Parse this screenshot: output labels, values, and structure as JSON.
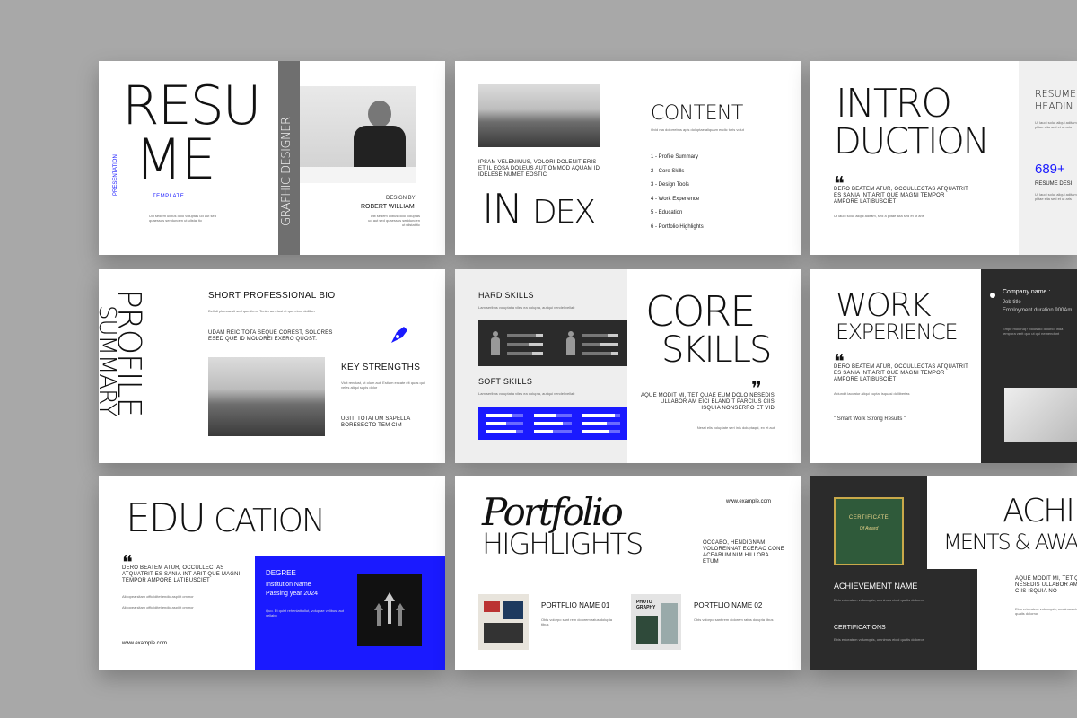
{
  "slide1": {
    "title_top": "RESU",
    "title_bottom": "ME",
    "presentation": "PRESENTATION",
    "template": "TEMPLATE",
    "vertical": "GRAPHIC DESIGNER",
    "design_by": "DESIGN BY",
    "author": "ROBERT WILLIAM",
    "body": "Ulit sedem ulibus dolo voluptas ud aut sed quaessus seridunden ut ulistat tic"
  },
  "slide2": {
    "tagline": "IPSAM VELENIMUS, VOLORI DOLENIT ERIS ET IL EOSA DOLEUS AUT OMMOD AQUAM ID IDELESE NUMET EOSTIC",
    "in": "IN",
    "dex": "DEX",
    "content": "CONTENT",
    "content_sub": "Ovid ma dolorrebus apis doluptae aliquam endic toris volut",
    "items": [
      "1 - Profile Summary",
      "2 - Core Skills",
      "3 - Design Tools",
      "4 - Work Experience",
      "5 - Education",
      "6 - Portfolio Highlights"
    ]
  },
  "slide3": {
    "title_top": "INTRO",
    "title_bottom": "DUCTION",
    "quote": "DERO BEATEM ATUR, OCCULLECTAS ATQUATRIT ES SANIA INT ARIT QUE MAGNI TEMPOR AMPORE LATIBUSCIET",
    "body": "Ut laudi solut aliqui aditam, sed a plitae sita sed et ut aris",
    "side_head_1": "RESUME",
    "side_head_2": "HEADIN",
    "number": "689+",
    "number_label": "RESUME DESI"
  },
  "slide4": {
    "vertical_1": "PROFILE",
    "vertical_2": "SUMMARY",
    "bio_title": "SHORT PROFESSIONAL BIO",
    "bio_body": "Dellidi plaecaesit sed quesitem. Tenim au etust et quo eiunt dolliber",
    "caps": "UDAM REIC TOTA SEQUE COREST, SOLORES ESED QUE ID MOLOREI EXERO QUOST.",
    "strengths": "KEY STRENGTHS",
    "strengths_body": "Vicit rendust, ut olum aut. Estiam excate elt quos qui veles aliqui sapis dolor",
    "caps_2": "UGIT, TOTATUM SAPELLA BORESECTO TEM CIM"
  },
  "slide5": {
    "hard": "HARD SKILLS",
    "hard_body": "Lam seribus voluptatia viles ea dolupta, autiqui vendel vellab",
    "soft": "SOFT SKILLS",
    "soft_body": "Lam seribus voluptatia viles ea dolupta, autiqui vendel vellab",
    "core": "CORE",
    "skills": "SKILLS",
    "quote": "AQUE MODIT MI, TET QUAE EUM DOLO NESEDIS ULLABOR AM EICI BLANDIT PARCIUS CIIS ISQUIA NONSERRO ET VID",
    "body": "Nessi elis voluptate seri inis doluptaqui, ex et aut"
  },
  "slide6": {
    "title_top": "WORK",
    "title_bottom": "EXPERIENCE",
    "quote": "DERO BEATEM ATUR, OCCULLECTAS ATQUATRIT ES SANIA INT ARIT QUE MAGNI TEMPOR AMPORE LATIBUSCIET",
    "body": "Aciundit laccatur aliqui cuptat isquasi dolliberias",
    "motto": "\" Smart Work Strong Results \"",
    "company": "Company name :",
    "job": "Job title",
    "duration": "Employment duration 900Am",
    "side_body": "Empe moloruq? Moosdio dolorio, inda tempora verit quo ut qui nemendunt"
  },
  "slide7": {
    "title_bold": "EDU",
    "title_thin": "CATION",
    "quote": "DERO BEATEM ATUR, OCCULLECTAS ATQUATRIT ES SANIA INT ARIT QUE MAGNI TEMPOR AMPORE LATIBUSCIET",
    "body": "Alicopea sitam officiiditet endic aspirit ommor",
    "url": "www.example.com",
    "degree": "DEGREE",
    "institution": "Institution Name",
    "year": "Passing year 2024",
    "box_body": "Quo. Et quist reheniatt ollut, voluptae velibust aut vellabo"
  },
  "slide8": {
    "title_script": "Portfolio",
    "title_caps": "HIGHLIGHTS",
    "url": "www.example.com",
    "quote": "OCCABO, HENDIGNAM VOLORENNAT ECERAC CONE ACEARUM NIM HILLORA ETUM",
    "p1": "PORTFLIO NAME 01",
    "p2": "PORTFLIO NAME 02",
    "p_body": "Obis volorpo sant rem dolorem ratus dolupta tibus",
    "photo_label": "PHOTO GRAPHY"
  },
  "slide9": {
    "title_1": "ACHIE",
    "title_2": "MENTS & AWA",
    "certificate": "CERTIFICATE",
    "cert_sub": "Of Award",
    "achievement": "ACHIEVEMENT NAME",
    "certifications": "CERTIFICATIONS",
    "body": "Ebis ericeatem volumquis, omnimus eicid quatis dolorror",
    "quote": "AQUE MODIT MI, TET Q NESEDIS ULLABOR AM CIIS ISQUIA NO"
  },
  "colors": {
    "accent_blue": "#1a1aff",
    "dark": "#2b2b2b",
    "background": "#a8a8a8"
  },
  "skill_levels": [
    0.8,
    0.6,
    0.7,
    0.5
  ]
}
